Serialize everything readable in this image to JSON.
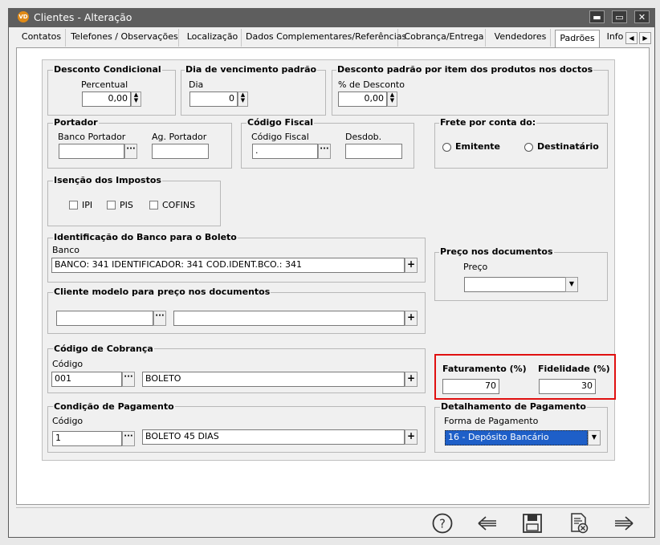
{
  "window": {
    "app_icon_text": "VD",
    "title": "Clientes - Alteração",
    "minimize": "▬",
    "maximize": "▭",
    "close": "✕"
  },
  "tabs": [
    {
      "label": "Contatos",
      "underline": "C"
    },
    {
      "label": "Telefones / Observações"
    },
    {
      "label": "Localização"
    },
    {
      "label": "Dados Complementares/Referências"
    },
    {
      "label": "Cobrança/Entrega"
    },
    {
      "label": "Vendedores"
    },
    {
      "label": "Padrões",
      "active": true
    },
    {
      "label": "Info"
    }
  ],
  "tab_scroll": {
    "left": "◀",
    "right": "▶"
  },
  "desconto_condicional": {
    "title": "Desconto Condicional",
    "label": "Percentual",
    "value": "0,00"
  },
  "dia_vencimento": {
    "title": "Dia de vencimento padrão",
    "label": "Dia",
    "value": "0"
  },
  "desconto_item": {
    "title": "Desconto padrão por item dos produtos nos doctos",
    "label": "% de Desconto",
    "value": "0,00"
  },
  "portador": {
    "title": "Portador",
    "banco_label": "Banco Portador",
    "banco_value": "",
    "ag_label": "Ag. Portador",
    "ag_value": ""
  },
  "codigo_fiscal": {
    "title": "Código Fiscal",
    "codigo_label": "Código Fiscal",
    "codigo_value": ".",
    "desdob_label": "Desdob.",
    "desdob_value": ""
  },
  "frete": {
    "title": "Frete por conta do:",
    "opt1": "Emitente",
    "opt2": "Destinatário"
  },
  "isencao": {
    "title": "Isenção dos Impostos",
    "ipi": "IPI",
    "pis": "PIS",
    "cofins": "COFINS"
  },
  "banco_boleto": {
    "title": "Identificação do Banco para o Boleto",
    "label": "Banco",
    "value": "BANCO: 341 IDENTIFICADOR: 341 COD.IDENT.BCO.: 341"
  },
  "preco_docs": {
    "title": "Preço nos documentos",
    "label": "Preço",
    "value": ""
  },
  "cliente_modelo": {
    "title": "Cliente modelo para preço nos documentos",
    "code_value": "",
    "desc_value": ""
  },
  "codigo_cobranca": {
    "title": "Código de Cobrança",
    "label": "Código",
    "code": "001",
    "desc": "BOLETO"
  },
  "faturamento": {
    "fat_label": "Faturamento (%)",
    "fat_value": "70",
    "fid_label": "Fidelidade (%)",
    "fid_value": "30"
  },
  "condicao_pagamento": {
    "title": "Condição de Pagamento",
    "label": "Código",
    "code": "1",
    "desc": "BOLETO 45 DIAS"
  },
  "detalhamento": {
    "title": "Detalhamento de Pagamento",
    "label": "Forma de Pagamento",
    "value": "16 - Depósito Bancário"
  },
  "footer": {
    "help": "?",
    "back": "⇐",
    "save": "💾",
    "cancel": "🗎",
    "next": "⇒"
  }
}
